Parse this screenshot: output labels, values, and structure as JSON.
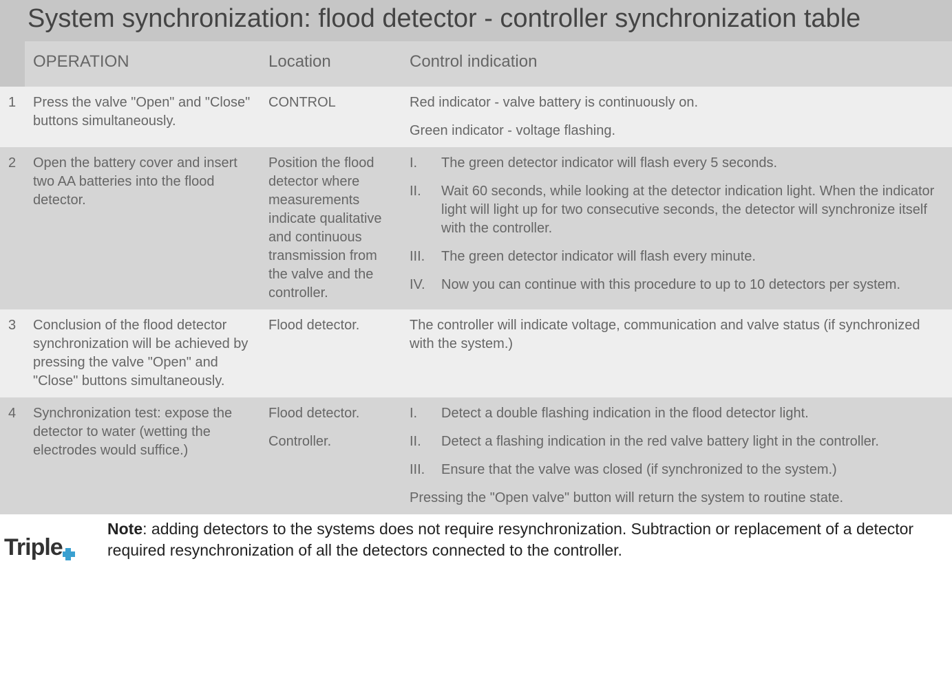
{
  "title": "System synchronization: flood detector - controller synchronization table",
  "headers": {
    "num": "",
    "operation": "OPERATION",
    "location": "Location",
    "indication": "Control indication"
  },
  "rows": [
    {
      "num": "1",
      "operation": "Press the valve \"Open\" and \"Close\" buttons simultaneously.",
      "location": "CONTROL",
      "indication_paras": [
        "Red indicator - valve battery is continuously on.",
        "Green indicator - voltage flashing."
      ]
    },
    {
      "num": "2",
      "operation": "Open the battery cover and insert two AA batteries into the flood detector.",
      "location": "Position the flood detector where measurements indicate qualitative and continuous transmission from the valve and the controller.",
      "indication_list": [
        {
          "roman": "I.",
          "text": "The green detector indicator will flash every 5 seconds."
        },
        {
          "roman": "II.",
          "text": "Wait 60 seconds, while looking at the detector indication light.  When the indicator light will light up for two consecutive seconds, the detector will synchronize itself with the controller."
        },
        {
          "roman": "III.",
          "text": "The green detector indicator will flash every minute."
        },
        {
          "roman": "IV.",
          "text": "Now you can continue with this procedure to up to 10 detectors per system."
        }
      ]
    },
    {
      "num": "3",
      "operation": "Conclusion of the flood detector synchronization will be achieved by pressing the valve \"Open\" and \"Close\" buttons simultaneously.",
      "location": "Flood detector.",
      "indication_paras": [
        "The controller will indicate voltage, communication and valve status (if synchronized with the system.)"
      ]
    },
    {
      "num": "4",
      "operation": "Synchronization test: expose the detector to water (wetting the electrodes would suffice.)",
      "location_paras": [
        "Flood detector.",
        "Controller."
      ],
      "indication_list": [
        {
          "roman": "I.",
          "text": "Detect a double flashing indication in the flood detector light."
        },
        {
          "roman": "II.",
          "text": "Detect a flashing indication in the red valve battery light in the controller."
        },
        {
          "roman": "III.",
          "text": "Ensure that the valve was closed (if synchronized to the system.)"
        }
      ],
      "indication_tail": "Pressing the \"Open valve\" button will return the system to routine state."
    }
  ],
  "footer": {
    "logo": "Triple",
    "note_label": "Note",
    "note_rest": ": adding detectors to the systems does not require resynchronization. Subtraction or replacement of a detector required resynchronization of all the detectors connected to the controller."
  }
}
